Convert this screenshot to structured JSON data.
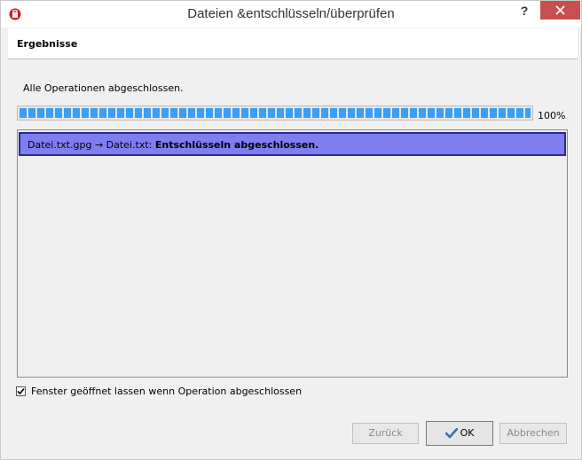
{
  "window": {
    "title": "Dateien &entschlüsseln/überprüfen",
    "help": "?"
  },
  "header": {
    "title": "Ergebnisse"
  },
  "status": {
    "text": "Alle Operationen abgeschlossen."
  },
  "progress": {
    "value": 1.0,
    "label": "100%"
  },
  "results": [
    {
      "source": "Datei.txt.gpg",
      "arrow": "→",
      "target": "Datei.txt:",
      "message": "Entschlüsseln abgeschlossen."
    }
  ],
  "options": {
    "keep_open_label": "Fenster geöffnet lassen wenn Operation abgeschlossen",
    "keep_open_checked": true
  },
  "buttons": {
    "back": "Zurück",
    "ok": "OK",
    "cancel": "Abbrechen"
  },
  "colors": {
    "close": "#c74f50",
    "progress": "#3c9ef4",
    "selection": "#7e7ef0"
  }
}
